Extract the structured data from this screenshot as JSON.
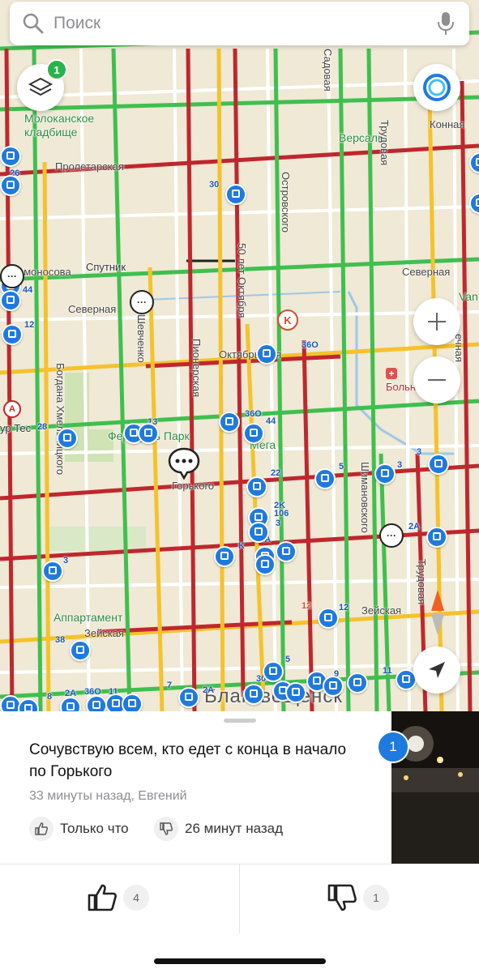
{
  "search": {
    "placeholder": "Поиск"
  },
  "layers": {
    "badge": "1"
  },
  "map": {
    "places": {
      "cemetery": "Молоканское\nкладбище",
      "sputnik": "Спутник",
      "versal": "Версаль",
      "ferris_park": "Ферр__ль Парк",
      "mega": "Мега",
      "hospital": "Больница",
      "apartament": "Аппартамент",
      "tur_tes": "ур Тес",
      "city": "Благовещенск"
    },
    "streets": {
      "proletarskaya": "Пролетарская",
      "konnaya": "Конная",
      "lomonosova": "омоносова",
      "severnaya_left": "Северная",
      "severnaya_right": "Северная",
      "oktyabrskaya": "Октябрьская",
      "gorkogo": "Горького",
      "zeyskaya_left": "Зейская",
      "zeyskaya_right": "Зейская",
      "pionerskaya": "Пионерская",
      "let50": "50 лет Октября",
      "ostrovskogo": "Островского",
      "trudovaya_top": "Трудовая",
      "trudovaya_bottom": "Трудовая",
      "shimanovskogo": "Шимановского",
      "bogdana": "Богдана Хмельницкого",
      "shevchenko": "Шевченко",
      "sadovaya": "Садовая",
      "pechnaya": "ечная",
      "van": "Van"
    },
    "routes": [
      "26",
      "30",
      "44",
      "12",
      "28",
      "13",
      "36O",
      "44",
      "36O",
      "22",
      "5",
      "3",
      "3",
      "2K",
      "106",
      "3",
      "44A",
      "K",
      "2A",
      "3",
      "12",
      "12",
      "38",
      "5",
      "30",
      "9",
      "11",
      "7",
      "2A",
      "8",
      "2A",
      "36O",
      "11"
    ]
  },
  "post": {
    "text": "Сочувствую всем, кто едет с конца в начало по Горького",
    "meta": "33 минуты назад, Евгений",
    "like_label": "Только что",
    "dislike_label": "26 минут назад",
    "photo_badge": "1"
  },
  "votes": {
    "likes": "4",
    "dislikes": "1"
  },
  "colors": {
    "green": "#3fbf4f",
    "yellow": "#f5c22b",
    "red": "#c0272d",
    "blue": "#1f7ae0"
  }
}
